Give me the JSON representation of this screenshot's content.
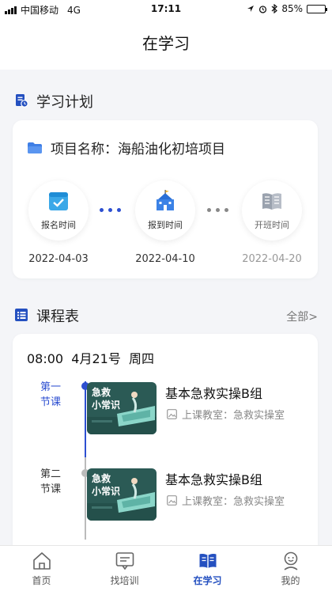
{
  "status_bar": {
    "carrier": "中国移动",
    "network": "4G",
    "time": "17:11",
    "battery": "85%",
    "battery_level": 0.85
  },
  "header": {
    "title": "在学习"
  },
  "study_plan": {
    "section_title": "学习计划",
    "project_label": "项目名称：海船油化初培项目",
    "steps": [
      {
        "label": "报名时间",
        "date": "2022-04-03",
        "icon": "calendar-check-icon"
      },
      {
        "label": "报到时间",
        "date": "2022-04-10",
        "icon": "school-building-icon"
      },
      {
        "label": "开班时间",
        "date": "2022-04-20",
        "icon": "open-book-icon"
      }
    ]
  },
  "schedule": {
    "section_title": "课程表",
    "more_label": "全部>",
    "date_line": "08:00  4月21号  周四",
    "courses": [
      {
        "period_line1": "第一",
        "period_line2": "节课",
        "title": "基本急救实操B组",
        "room": "上课教室：急救实操室",
        "thumb_line1": "急救",
        "thumb_line2": "小常识"
      },
      {
        "period_line1": "第二",
        "period_line2": "节课",
        "title": "基本急救实操B组",
        "room": "上课教室：急救实操室",
        "thumb_line1": "急救",
        "thumb_line2": "小常识"
      }
    ]
  },
  "tab_bar": {
    "tabs": [
      {
        "label": "首页",
        "icon": "home-icon"
      },
      {
        "label": "找培训",
        "icon": "message-board-icon"
      },
      {
        "label": "在学习",
        "icon": "book-icon",
        "active": true
      },
      {
        "label": "我的",
        "icon": "profile-face-icon"
      }
    ]
  },
  "colors": {
    "accent": "#2450c0",
    "timeline_active": "#2d4fd1",
    "timeline_idle": "#bbbbbb",
    "thumb_bg": "#2b5a55",
    "thumb_accent": "#8bd6c9"
  }
}
